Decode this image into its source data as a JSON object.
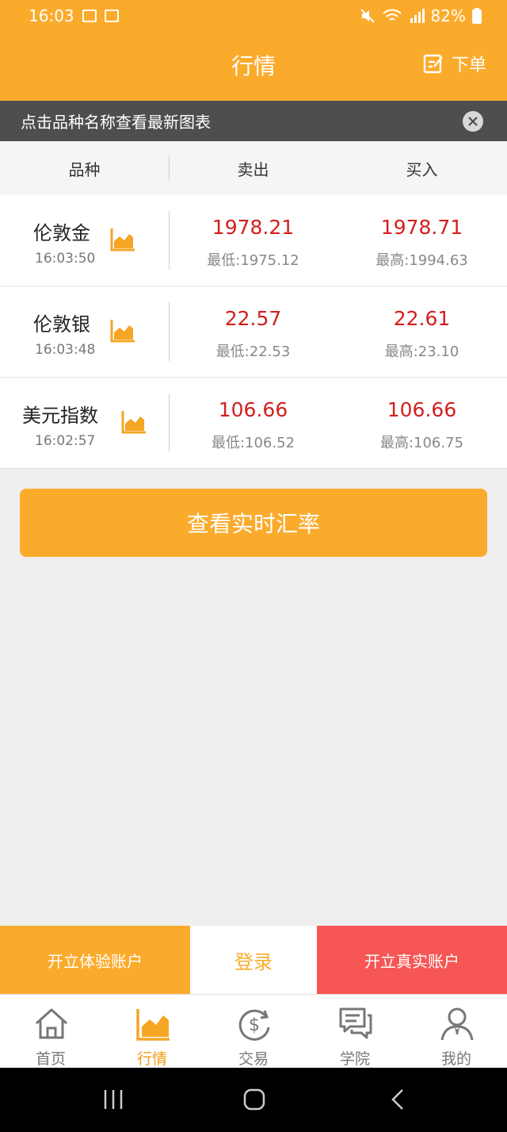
{
  "status": {
    "time": "16:03",
    "battery": "82%"
  },
  "header": {
    "title": "行情",
    "order_label": "下单"
  },
  "notice": {
    "text": "点击品种名称查看最新图表"
  },
  "table": {
    "headers": [
      "品种",
      "卖出",
      "买入"
    ]
  },
  "quotes": [
    {
      "name": "伦敦金",
      "time": "16:03:50",
      "sell": "1978.21",
      "low": "最低:1975.12",
      "buy": "1978.71",
      "high": "最高:1994.63"
    },
    {
      "name": "伦敦银",
      "time": "16:03:48",
      "sell": "22.57",
      "low": "最低:22.53",
      "buy": "22.61",
      "high": "最高:23.10"
    },
    {
      "name": "美元指数",
      "time": "16:02:57",
      "sell": "106.66",
      "low": "最低:106.52",
      "buy": "106.66",
      "high": "最高:106.75"
    }
  ],
  "rate_button": "查看实时汇率",
  "account": {
    "demo": "开立体验账户",
    "login": "登录",
    "real": "开立真实账户"
  },
  "tabs": [
    "首页",
    "行情",
    "交易",
    "学院",
    "我的"
  ],
  "colors": {
    "accent": "#fbab2c",
    "price": "#d21f1f",
    "real_account": "#f65654"
  }
}
